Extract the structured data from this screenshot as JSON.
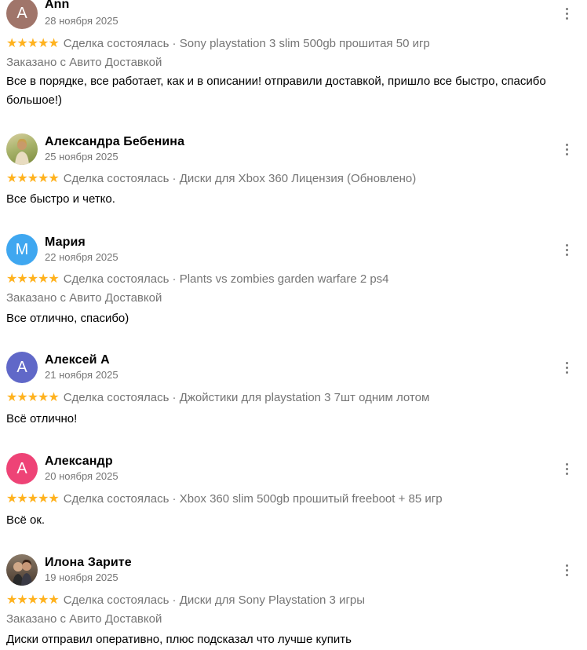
{
  "reviews": [
    {
      "name": "Ann",
      "date": "28 ноября 2025",
      "avatar_letter": "A",
      "avatar_color": "#a0756a",
      "stars": "★★★★★",
      "deal": "Сделка состоялась · Sony playstation 3 slim 500gb прошитая 50 игр",
      "delivery": "Заказано с Авито Доставкой",
      "text": "Все в порядке, все работает, как и в описании! отправили доставкой, пришло все быстро, спасибо большое!)"
    },
    {
      "name": "Александра Бебенина",
      "date": "25 ноября 2025",
      "avatar_letter": "",
      "avatar_color": "#c4b27e",
      "stars": "★★★★★",
      "deal": "Сделка состоялась · Диски для Xbox 360 Лицензия (Обновлено)",
      "delivery": "",
      "text": "Все быстро и четко."
    },
    {
      "name": "Мария",
      "date": "22 ноября 2025",
      "avatar_letter": "М",
      "avatar_color": "#3fa7f0",
      "stars": "★★★★★",
      "deal": "Сделка состоялась · Plants vs zombies garden warfare 2 ps4",
      "delivery": "Заказано с Авито Доставкой",
      "text": "Все отлично, спасибо)"
    },
    {
      "name": "Алексей А",
      "date": "21 ноября 2025",
      "avatar_letter": "А",
      "avatar_color": "#6068c8",
      "stars": "★★★★★",
      "deal": "Сделка состоялась · Джойстики для playstation 3 7шт одним лотом",
      "delivery": "",
      "text": "Всё отлично!"
    },
    {
      "name": "Александр",
      "date": "20 ноября 2025",
      "avatar_letter": "А",
      "avatar_color": "#ee4376",
      "stars": "★★★★★",
      "deal": "Сделка состоялась · Xbox 360 slim 500gb прошитый freeboot + 85 игр",
      "delivery": "",
      "text": "Всё ок."
    },
    {
      "name": "Илона Зарите",
      "date": "19 ноября 2025",
      "avatar_letter": "",
      "avatar_color": "#5a4a3a",
      "stars": "★★★★★",
      "deal": "Сделка состоялась · Диски для Sony Playstation 3 игры",
      "delivery": "Заказано с Авито Доставкой",
      "text": "Диски отправил оперативно, плюс подсказал что лучше купить"
    }
  ]
}
